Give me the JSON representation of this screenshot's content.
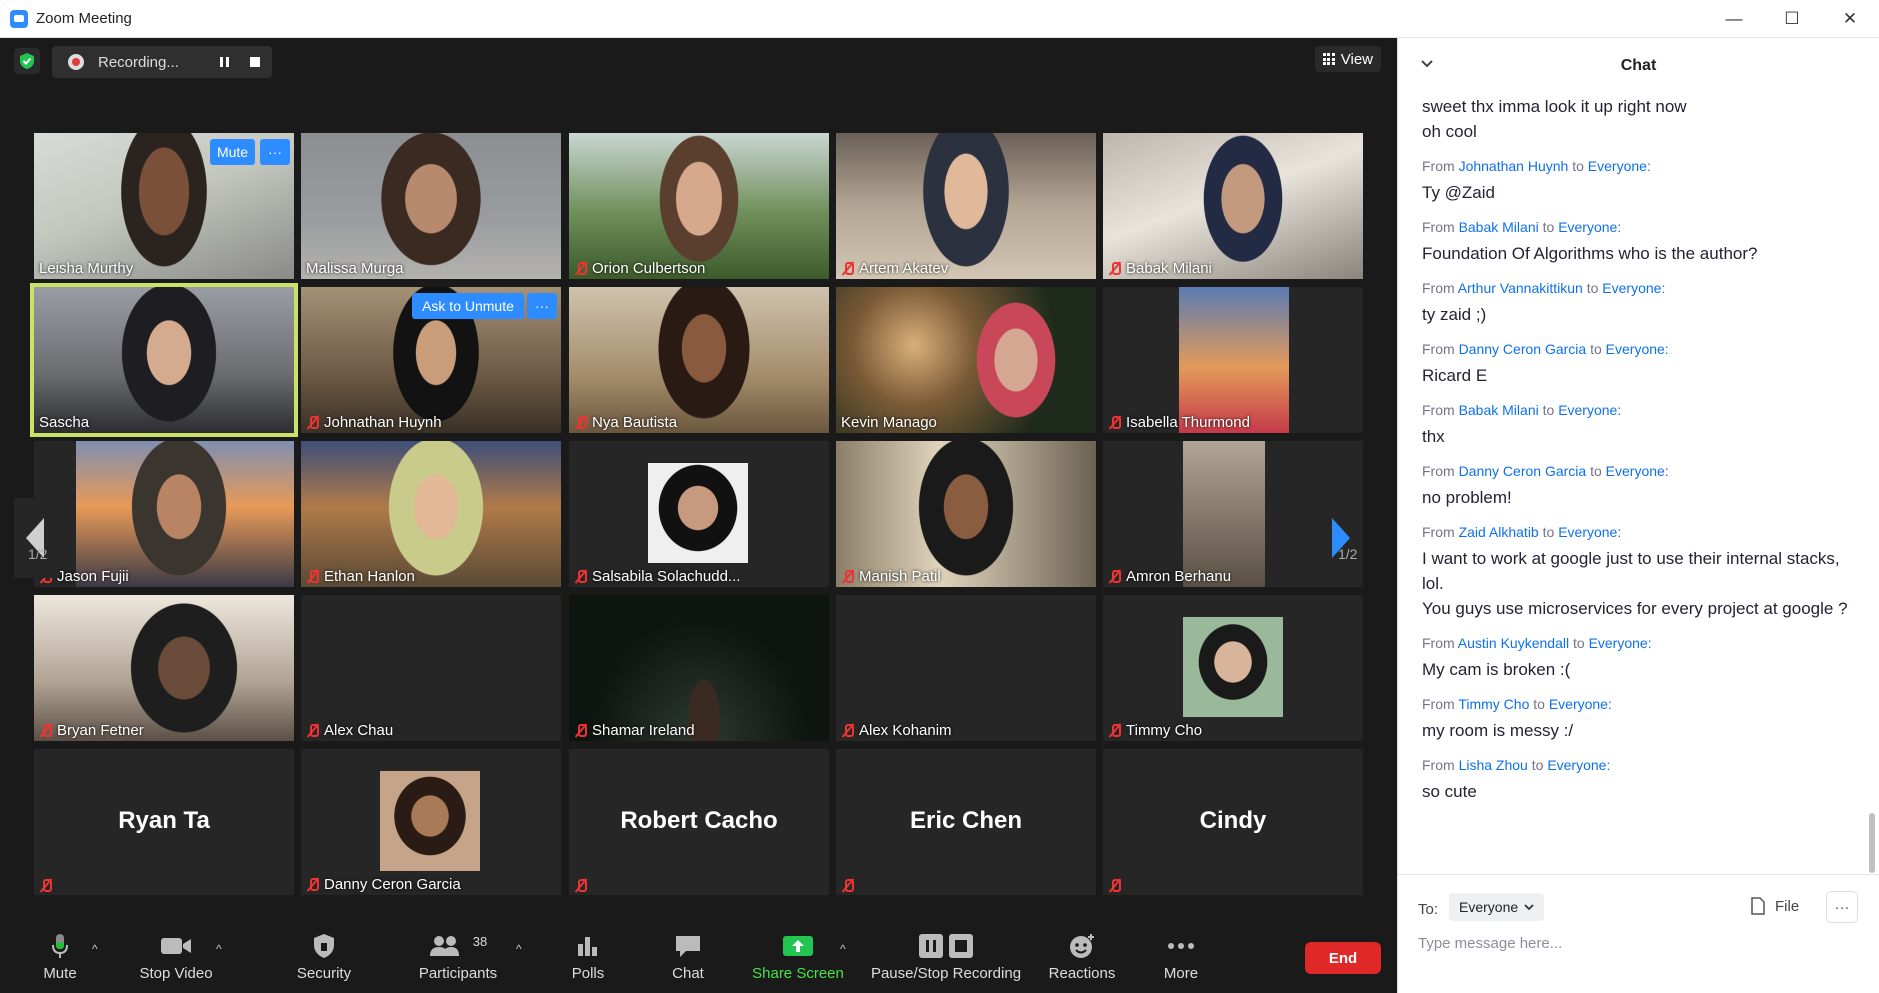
{
  "window": {
    "title": "Zoom Meeting",
    "minimize": "—",
    "maximize": "☐",
    "close": "✕"
  },
  "topbar": {
    "recording_label": "Recording...",
    "view_label": "View"
  },
  "pagination": {
    "left": "1/2",
    "right": "1/2"
  },
  "tiles": [
    {
      "name": "Leisha Murthy",
      "muted": false
    },
    {
      "name": "Malissa Murga",
      "muted": false
    },
    {
      "name": "Orion Culbertson",
      "muted": true
    },
    {
      "name": "Artem Akatev",
      "muted": true
    },
    {
      "name": "Babak Milani",
      "muted": true
    },
    {
      "name": "Sascha",
      "muted": false
    },
    {
      "name": "Johnathan Huynh",
      "muted": true
    },
    {
      "name": "Nya Bautista",
      "muted": true
    },
    {
      "name": "Kevin Manago",
      "muted": false
    },
    {
      "name": "Isabella Thurmond",
      "muted": true
    },
    {
      "name": "Jason Fujii",
      "muted": true
    },
    {
      "name": "Ethan Hanlon",
      "muted": true
    },
    {
      "name": "Salsabila Solachudd...",
      "muted": true
    },
    {
      "name": "Manish Patil",
      "muted": true
    },
    {
      "name": "Amron Berhanu",
      "muted": true
    },
    {
      "name": "Bryan Fetner",
      "muted": true
    },
    {
      "name": "Alex Chau",
      "muted": true
    },
    {
      "name": "Shamar Ireland",
      "muted": true
    },
    {
      "name": "Alex Kohanim",
      "muted": true
    },
    {
      "name": "Timmy Cho",
      "muted": true
    },
    {
      "name": "Ryan Ta",
      "muted": true,
      "no_video": true
    },
    {
      "name": "Danny Ceron Garcia",
      "muted": true
    },
    {
      "name": "Robert Cacho",
      "muted": true,
      "no_video": true
    },
    {
      "name": "Eric Chen",
      "muted": true,
      "no_video": true
    },
    {
      "name": "Cindy",
      "muted": true,
      "no_video": true
    }
  ],
  "tile_buttons": {
    "mute": "Mute",
    "ask_unmute": "Ask to Unmute",
    "more": "···"
  },
  "toolbar": {
    "mute": "Mute",
    "stop_video": "Stop Video",
    "security": "Security",
    "participants": "Participants",
    "participants_count": "38",
    "polls": "Polls",
    "chat": "Chat",
    "share_screen": "Share Screen",
    "pause_stop_recording": "Pause/Stop Recording",
    "reactions": "Reactions",
    "more": "More",
    "end": "End"
  },
  "chat": {
    "title": "Chat",
    "top_lines": [
      "sweet thx imma look it up right now",
      "oh cool"
    ],
    "from_word": "From",
    "to_word": "to",
    "messages": [
      {
        "from": "Johnathan Huynh",
        "to": "Everyone:",
        "text": [
          "Ty @Zaid"
        ]
      },
      {
        "from": "Babak Milani",
        "to": "Everyone:",
        "text": [
          "Foundation Of Algorithms who is the author?"
        ]
      },
      {
        "from": "Arthur Vannakittikun",
        "to": "Everyone:",
        "text": [
          "ty zaid ;)"
        ]
      },
      {
        "from": "Danny Ceron Garcia",
        "to": "Everyone:",
        "text": [
          "Ricard E"
        ]
      },
      {
        "from": "Babak Milani",
        "to": "Everyone:",
        "text": [
          "thx"
        ]
      },
      {
        "from": "Danny Ceron Garcia",
        "to": "Everyone:",
        "text": [
          "no problem!"
        ]
      },
      {
        "from": "Zaid Alkhatib",
        "to": "Everyone:",
        "text": [
          "I want to work at google just to use their internal stacks, lol.",
          "You guys use microservices for every project at google ?"
        ]
      },
      {
        "from": "Austin Kuykendall",
        "to": "Everyone:",
        "text": [
          "My cam is broken :("
        ]
      },
      {
        "from": "Timmy Cho",
        "to": "Everyone:",
        "text": [
          "my room is messy :/"
        ]
      },
      {
        "from": "Lisha Zhou",
        "to": "Everyone:",
        "text": [
          "so cute"
        ]
      }
    ],
    "to_label": "To:",
    "to_value": "Everyone",
    "file_label": "File",
    "more_label": "···",
    "input_placeholder": "Type message here..."
  },
  "colors": {
    "accent": "#2D8CFF",
    "end": "#E02828",
    "share": "#4CE04C",
    "active_speaker": "#C9E267",
    "chat_link": "#0E71EB"
  }
}
